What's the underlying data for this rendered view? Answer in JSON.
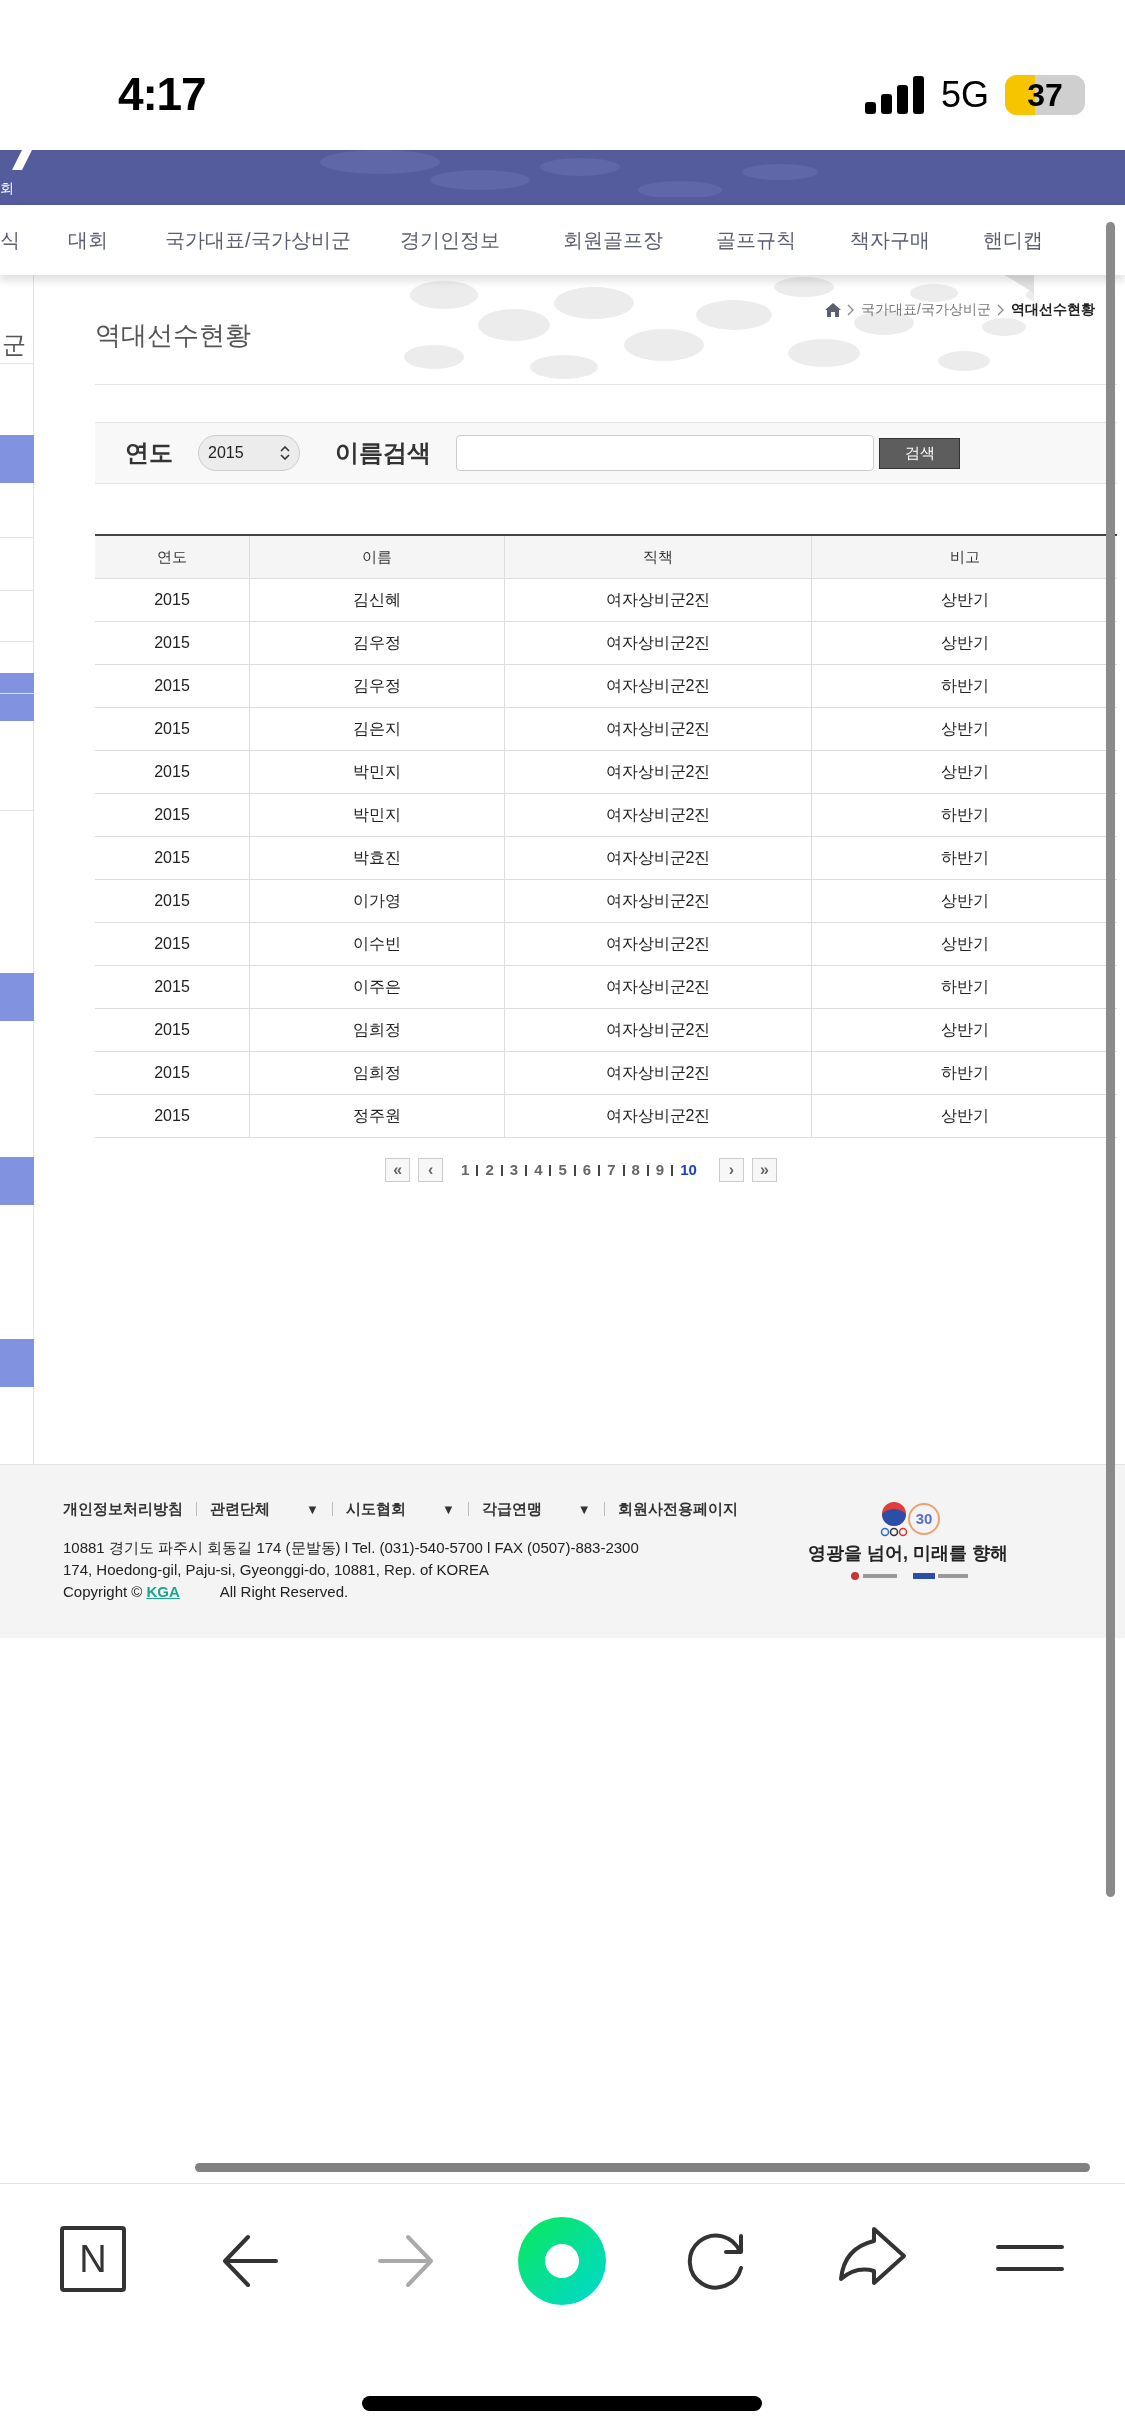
{
  "status_bar": {
    "time": "4:17",
    "network": "5G",
    "battery": "37"
  },
  "site_header": {
    "logo_fragment": "회"
  },
  "nav": {
    "items": [
      {
        "label": "식"
      },
      {
        "label": "대회"
      },
      {
        "label": "국가대표/국가상비군"
      },
      {
        "label": "경기인정보"
      },
      {
        "label": "회원골프장"
      },
      {
        "label": "골프규칙"
      },
      {
        "label": "책자구매"
      },
      {
        "label": "핸디캡"
      }
    ]
  },
  "sidebar": {
    "label": "군"
  },
  "page": {
    "title": "역대선수현황",
    "breadcrumb": [
      {
        "label": "국가대표/국가상비군",
        "current": false
      },
      {
        "label": "역대선수현황",
        "current": true
      }
    ]
  },
  "search": {
    "year_label": "연도",
    "year_value": "2015",
    "name_label": "이름검색",
    "button": "검색"
  },
  "table": {
    "columns": [
      "연도",
      "이름",
      "직책",
      "비고"
    ],
    "rows": [
      [
        "2015",
        "김신혜",
        "여자상비군2진",
        "상반기"
      ],
      [
        "2015",
        "김우정",
        "여자상비군2진",
        "상반기"
      ],
      [
        "2015",
        "김우정",
        "여자상비군2진",
        "하반기"
      ],
      [
        "2015",
        "김은지",
        "여자상비군2진",
        "상반기"
      ],
      [
        "2015",
        "박민지",
        "여자상비군2진",
        "상반기"
      ],
      [
        "2015",
        "박민지",
        "여자상비군2진",
        "하반기"
      ],
      [
        "2015",
        "박효진",
        "여자상비군2진",
        "하반기"
      ],
      [
        "2015",
        "이가영",
        "여자상비군2진",
        "상반기"
      ],
      [
        "2015",
        "이수빈",
        "여자상비군2진",
        "상반기"
      ],
      [
        "2015",
        "이주은",
        "여자상비군2진",
        "하반기"
      ],
      [
        "2015",
        "임희정",
        "여자상비군2진",
        "상반기"
      ],
      [
        "2015",
        "임희정",
        "여자상비군2진",
        "하반기"
      ],
      [
        "2015",
        "정주원",
        "여자상비군2진",
        "상반기"
      ]
    ]
  },
  "pagination": {
    "first": "«",
    "prev": "‹",
    "next": "›",
    "last": "»",
    "pages": [
      {
        "label": "1",
        "selected": false
      },
      {
        "label": "2",
        "selected": false
      },
      {
        "label": "3",
        "selected": false
      },
      {
        "label": "4",
        "selected": false
      },
      {
        "label": "5",
        "selected": false
      },
      {
        "label": "6",
        "selected": false
      },
      {
        "label": "7",
        "selected": false
      },
      {
        "label": "8",
        "selected": false
      },
      {
        "label": "9",
        "selected": false
      },
      {
        "label": "10",
        "selected": true
      }
    ]
  },
  "footer": {
    "links": [
      {
        "label": "개인정보처리방침"
      },
      {
        "label": "관련단체",
        "toggle": "▼"
      },
      {
        "label": "시도협회",
        "toggle": "▼"
      },
      {
        "label": "각급연맹",
        "toggle": "▼"
      },
      {
        "label": "회원사전용페이지"
      }
    ],
    "address": "10881 경기도 파주시 회동길 174 (문발동) l Tel. (031)-540-5700 l FAX (0507)-883-2300",
    "address_en": "174, Hoedong-gil, Paju-si, Gyeonggi-do, 10881, Rep. of KOREA",
    "copyright_prefix": "Copyright ©",
    "copyright_link": "KGA",
    "copyright_suffix": "All Right Reserved.",
    "emblem_number": "30",
    "slogan": "영광을 넘어, 미래를 향해"
  },
  "browser_toolbar": {
    "tabs_letter": "N",
    "forward_disabled": true
  }
}
